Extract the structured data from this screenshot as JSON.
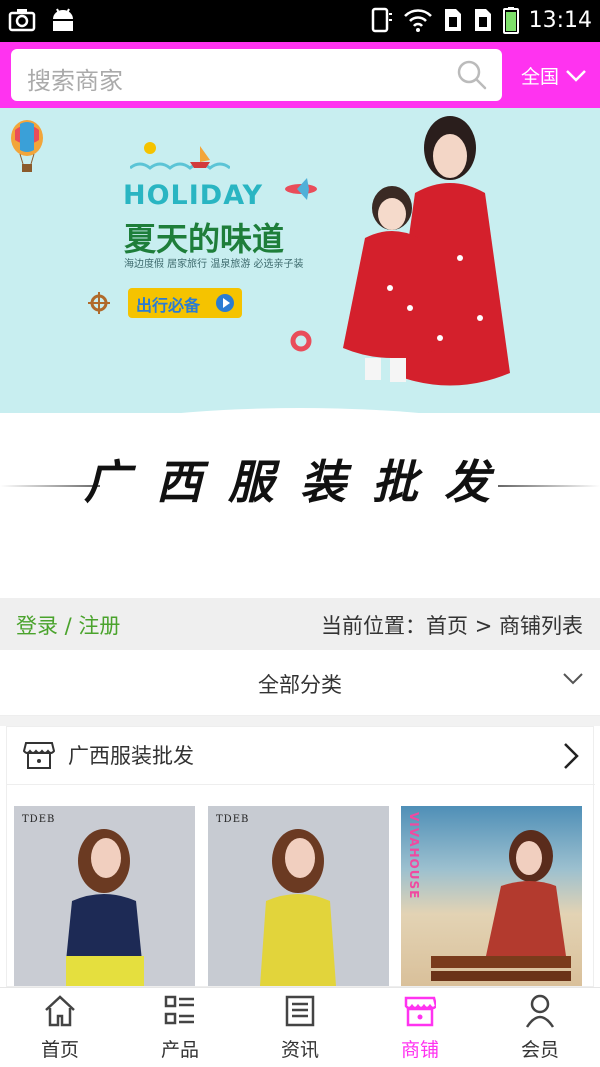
{
  "status_bar": {
    "time": "13:14",
    "icons": [
      "camera-icon",
      "android-icon",
      "vibrate-icon",
      "wifi-icon",
      "sim1-icon",
      "sim2-icon",
      "battery-icon"
    ]
  },
  "header": {
    "search_placeholder": "搜索商家",
    "region": "全国",
    "accent_color": "#ff33f0"
  },
  "banner": {
    "headline": "HOLIDAY",
    "title": "夏天的味道",
    "subtitle": "海边度假 居家旅行 温泉旅游 必选亲子装",
    "button": "出行必备"
  },
  "page_title": "广西服装批发",
  "breadcrumb": {
    "login": "登录 / 注册",
    "location": "当前位置：首页 > 商铺列表"
  },
  "category": {
    "label": "全部分类"
  },
  "shop": {
    "name": "广西服装批发",
    "products": [
      {
        "brand": "TDEB"
      },
      {
        "brand": "TDEB"
      },
      {
        "brand": "VIVAHOUSE"
      }
    ]
  },
  "bottom_nav": [
    {
      "label": "首页",
      "icon": "home-icon"
    },
    {
      "label": "产品",
      "icon": "grid-list-icon"
    },
    {
      "label": "资讯",
      "icon": "news-icon"
    },
    {
      "label": "商铺",
      "icon": "store-icon",
      "active": true
    },
    {
      "label": "会员",
      "icon": "user-icon"
    }
  ]
}
